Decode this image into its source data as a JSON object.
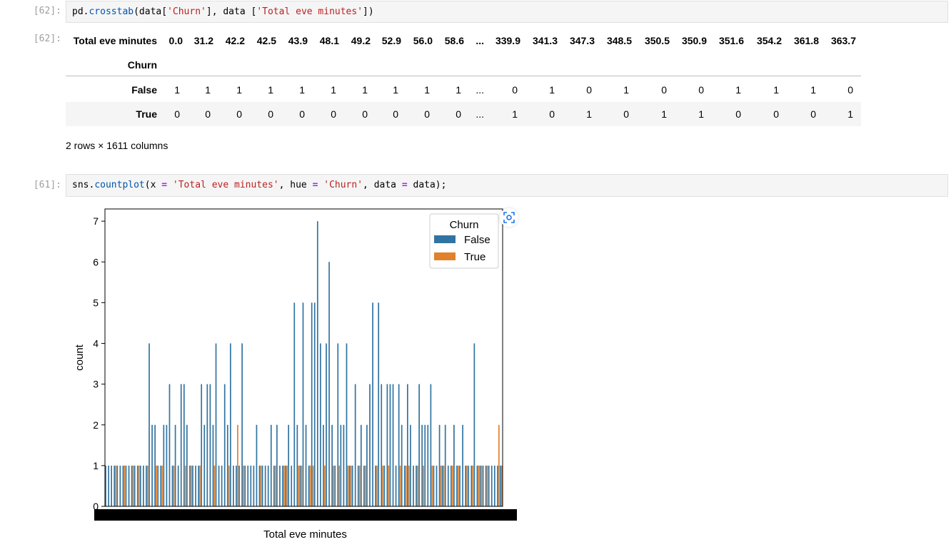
{
  "cells": [
    {
      "prompt_in": "[62]:",
      "code": "pd.crosstab(data['Churn'], data ['Total eve minutes'])",
      "prompt_out": "[62]:",
      "output": {
        "columns_name": "Total eve minutes",
        "index_name": "Churn",
        "columns": [
          "0.0",
          "31.2",
          "42.2",
          "42.5",
          "43.9",
          "48.1",
          "49.2",
          "52.9",
          "56.0",
          "58.6",
          "...",
          "339.9",
          "341.3",
          "347.3",
          "348.5",
          "350.5",
          "350.9",
          "351.6",
          "354.2",
          "361.8",
          "363.7"
        ],
        "rows": [
          {
            "label": "False",
            "values": [
              "1",
              "1",
              "1",
              "1",
              "1",
              "1",
              "1",
              "1",
              "1",
              "1",
              "...",
              "0",
              "1",
              "0",
              "1",
              "0",
              "0",
              "1",
              "1",
              "1",
              "0"
            ]
          },
          {
            "label": "True",
            "values": [
              "0",
              "0",
              "0",
              "0",
              "0",
              "0",
              "0",
              "0",
              "0",
              "0",
              "...",
              "1",
              "0",
              "1",
              "0",
              "1",
              "1",
              "0",
              "0",
              "0",
              "1"
            ]
          }
        ],
        "shape_note": "2 rows × 1611 columns"
      }
    },
    {
      "prompt_in": "[61]:",
      "code": "sns.countplot(x = 'Total eve minutes', hue = 'Churn', data = data);"
    }
  ],
  "chart_data": {
    "type": "bar",
    "xlabel": "Total eve minutes",
    "ylabel": "count",
    "ylim": [
      0,
      7.3
    ],
    "yticks": [
      0,
      1,
      2,
      3,
      4,
      5,
      6,
      7
    ],
    "legend": {
      "title": "Churn",
      "placement": "top-right",
      "entries": [
        "False",
        "True"
      ]
    },
    "series": [
      {
        "name": "False",
        "color": "#3274a1",
        "values": [
          1,
          1,
          1,
          1,
          1,
          1,
          1,
          1,
          1,
          1,
          1,
          1,
          1,
          1,
          1,
          4,
          2,
          2,
          1,
          1,
          2,
          2,
          3,
          1,
          2,
          1,
          3,
          3,
          2,
          1,
          1,
          1,
          1,
          3,
          2,
          3,
          3,
          2,
          4,
          1,
          1,
          3,
          2,
          4,
          1,
          1,
          1,
          4,
          1,
          1,
          1,
          1,
          2,
          1,
          1,
          1,
          1,
          2,
          1,
          2,
          1,
          1,
          1,
          2,
          1,
          5,
          2,
          1,
          5,
          2,
          1,
          5,
          5,
          7,
          4,
          2,
          4,
          6,
          2,
          1,
          4,
          2,
          2,
          4,
          1,
          1,
          3,
          1,
          2,
          1,
          2,
          3,
          5,
          1,
          5,
          3,
          1,
          3,
          3,
          3,
          1,
          3,
          2,
          1,
          3,
          2,
          1,
          1,
          3,
          2,
          2,
          2,
          3,
          1,
          1,
          2,
          1,
          2,
          1,
          1,
          2,
          1,
          1,
          2,
          1,
          1,
          1,
          4,
          1,
          1,
          1,
          1,
          1,
          1,
          1,
          1,
          1
        ]
      },
      {
        "name": "True",
        "color": "#e1812c",
        "values": [
          0,
          0,
          0,
          1,
          0,
          0,
          1,
          0,
          0,
          1,
          0,
          1,
          0,
          0,
          1,
          0,
          0,
          1,
          0,
          1,
          0,
          0,
          0,
          1,
          0,
          0,
          0,
          1,
          0,
          1,
          0,
          0,
          1,
          0,
          0,
          0,
          0,
          1,
          0,
          0,
          0,
          0,
          1,
          0,
          0,
          2,
          0,
          1,
          0,
          0,
          0,
          0,
          0,
          1,
          0,
          0,
          0,
          0,
          1,
          0,
          0,
          1,
          1,
          0,
          0,
          0,
          1,
          1,
          0,
          0,
          1,
          1,
          0,
          0,
          0,
          1,
          0,
          0,
          1,
          0,
          1,
          0,
          0,
          1,
          1,
          0,
          0,
          1,
          0,
          1,
          0,
          0,
          0,
          1,
          0,
          1,
          0,
          1,
          0,
          0,
          0,
          1,
          0,
          1,
          1,
          0,
          0,
          1,
          0,
          1,
          0,
          0,
          1,
          0,
          0,
          1,
          1,
          0,
          0,
          1,
          0,
          1,
          0,
          0,
          1,
          0,
          1,
          0,
          1,
          1,
          0,
          1,
          0,
          0,
          0,
          2,
          1
        ]
      }
    ]
  }
}
